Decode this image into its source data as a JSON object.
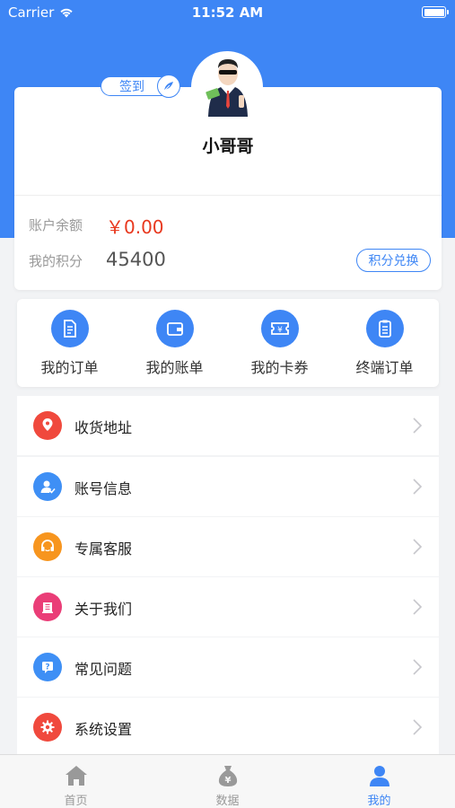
{
  "status_bar": {
    "carrier": "Carrier",
    "time": "11:52 AM"
  },
  "colors": {
    "primary": "#3e86f5",
    "balance": "#e8381e",
    "tab_inactive": "#999999"
  },
  "profile": {
    "checkin_label": "签到",
    "username": "小哥哥",
    "balance_label": "账户余额",
    "balance_value": "￥0.00",
    "points_label": "我的积分",
    "points_value": "45400",
    "exchange_label": "积分兑换"
  },
  "quick_actions": [
    {
      "label": "我的订单",
      "icon": "order-icon"
    },
    {
      "label": "我的账单",
      "icon": "wallet-icon"
    },
    {
      "label": "我的卡券",
      "icon": "coupon-icon"
    },
    {
      "label": "终端订单",
      "icon": "clipboard-icon"
    }
  ],
  "menu": [
    {
      "label": "收货地址",
      "icon": "location-icon",
      "color": "#f0493d"
    },
    {
      "label": "账号信息",
      "icon": "user-icon",
      "color": "#3e8ff5"
    },
    {
      "label": "专属客服",
      "icon": "headset-icon",
      "color": "#f7951e"
    },
    {
      "label": "关于我们",
      "icon": "building-icon",
      "color": "#ea3d77"
    },
    {
      "label": "常见问题",
      "icon": "question-icon",
      "color": "#3e8ff5"
    },
    {
      "label": "系统设置",
      "icon": "gear-icon",
      "color": "#f0493d"
    }
  ],
  "tabs": [
    {
      "label": "首页",
      "icon": "home-icon",
      "active": false
    },
    {
      "label": "数据",
      "icon": "money-bag-icon",
      "active": false
    },
    {
      "label": "我的",
      "icon": "person-icon",
      "active": true
    }
  ]
}
